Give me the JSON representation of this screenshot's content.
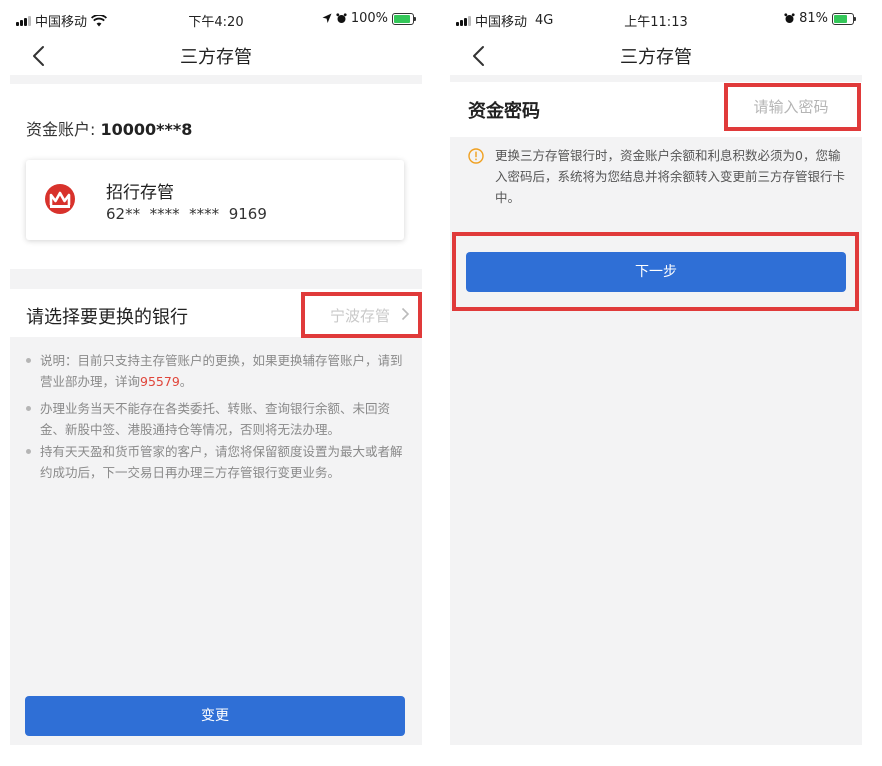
{
  "left": {
    "status": {
      "carrier": "中国移动",
      "time": "下午4:20",
      "battery": "100%",
      "battery_level": 1.0
    },
    "nav": {
      "title": "三方存管"
    },
    "account": {
      "label": "资金账户: ",
      "value": "10000***8"
    },
    "bank_card": {
      "name": "招行存管",
      "number": "62**  ****  ****  9169"
    },
    "select": {
      "label": "请选择要更换的银行",
      "value": "宁波存管"
    },
    "notes": {
      "n1_prefix": "说明：目前只支持主存管账户的更换，如果更换辅存管账户，请到营业部办理，详询",
      "n1_phone": "95579",
      "n1_suffix": "。",
      "n2": "办理业务当天不能存在各类委托、转账、查询银行余额、未回资金、新股中签、港股通持仓等情况，否则将无法办理。",
      "n3": "持有天天盈和货币管家的客户，请您将保留额度设置为最大或者解约成功后，下一交易日再办理三方存管银行变更业务。"
    },
    "button": {
      "label": "变更"
    }
  },
  "right": {
    "status": {
      "carrier": "中国移动",
      "network": "4G",
      "time": "上午11:13",
      "battery": "81%",
      "battery_level": 0.81
    },
    "nav": {
      "title": "三方存管"
    },
    "password": {
      "label": "资金密码",
      "placeholder": "请输入密码"
    },
    "warning": "更换三方存管银行时，资金账户余额和利息积数必须为0，您输入密码后，系统将为您结息并将余额转入变更前三方存管银行卡中。",
    "button": {
      "label": "下一步"
    }
  },
  "colors": {
    "primary_button": "#2f6fd6",
    "highlight_box": "#e03a3a",
    "warning_icon": "#f0a020",
    "phone_link": "#e0453a"
  }
}
